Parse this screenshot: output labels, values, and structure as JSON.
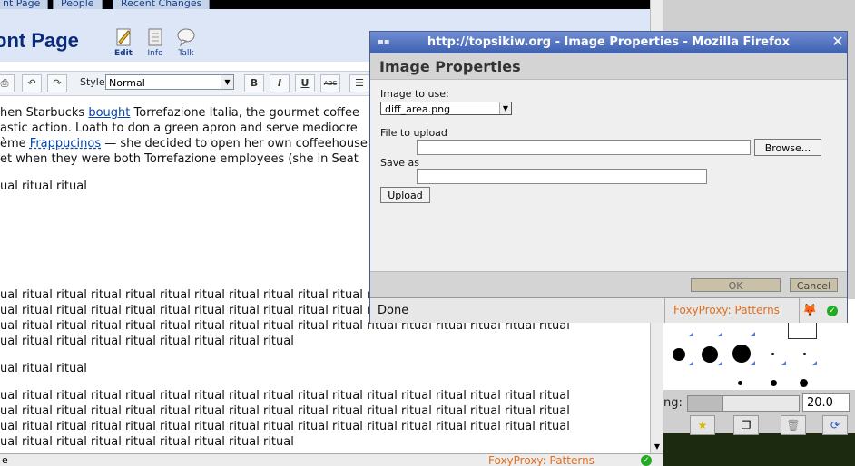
{
  "editor": {
    "tabs": [
      "nt Page",
      "People",
      "Recent Changes"
    ],
    "page_title": "ont Page",
    "header_icons": [
      {
        "label": "Edit",
        "icon": "edit-icon"
      },
      {
        "label": "Info",
        "icon": "info-icon"
      },
      {
        "label": "Talk",
        "icon": "talk-icon"
      }
    ],
    "toolbar": {
      "style_label": "Style",
      "style_value": "Normal",
      "bold": "B",
      "italic": "I",
      "underline": "U",
      "strike": "ABC"
    },
    "body": {
      "p1_a": "hen Starbucks ",
      "p1_link1": "bought",
      "p1_b": " Torrefazione Italia, the gourmet coffee",
      "p2": "astic action. Loath to don a green apron and serve mediocre",
      "p3_a": "ème ",
      "p3_link": "Frappucinos",
      "p3_b": " — she decided to open her own coffeehouse",
      "p4": "et when they were both Torrefazione employees (she in Seat",
      "r1": "ual ritual ritual",
      "r2": "ual ritual ritual ritual ritual ritual ritual ritual ritual ritual ritual ritua",
      "r3": "ual ritual ritual ritual ritual ritual ritual ritual ritual ritual ritual ritua",
      "r4": "ual ritual ritual ritual ritual ritual ritual ritual ritual ritual ritual ritual ritual ritual ritual ritual ritual",
      "r5": "ual ritual ritual ritual ritual ritual ritual ritual ritual",
      "r6": "ual ritual ritual",
      "r7": "ual ritual ritual ritual ritual ritual ritual ritual ritual ritual ritual ritual ritual ritual ritual ritual ritual",
      "r8": "ual ritual ritual ritual ritual ritual ritual ritual ritual ritual ritual ritual ritual ritual ritual ritual ritual",
      "r9": "ual ritual ritual ritual ritual ritual ritual ritual ritual ritual ritual ritual ritual ritual ritual ritual ritual",
      "r10": "ual ritual ritual ritual ritual ritual ritual ritual ritual"
    },
    "status_text": "e",
    "foxyproxy": "FoxyProxy: Patterns"
  },
  "palette": {
    "spacing_label": "ng:",
    "spacing_value": "20.0"
  },
  "dialog": {
    "window_title": "http://topsikiw.org - Image Properties - Mozilla Firefox",
    "heading": "Image Properties",
    "image_to_use_label": "Image to use:",
    "image_to_use_value": "diff_area.png",
    "file_to_upload_label": "File to upload",
    "browse_label": "Browse...",
    "save_as_label": "Save as",
    "upload_label": "Upload",
    "ok_label": "OK",
    "cancel_label": "Cancel",
    "status_text": "Done",
    "foxyproxy": "FoxyProxy: Patterns"
  }
}
